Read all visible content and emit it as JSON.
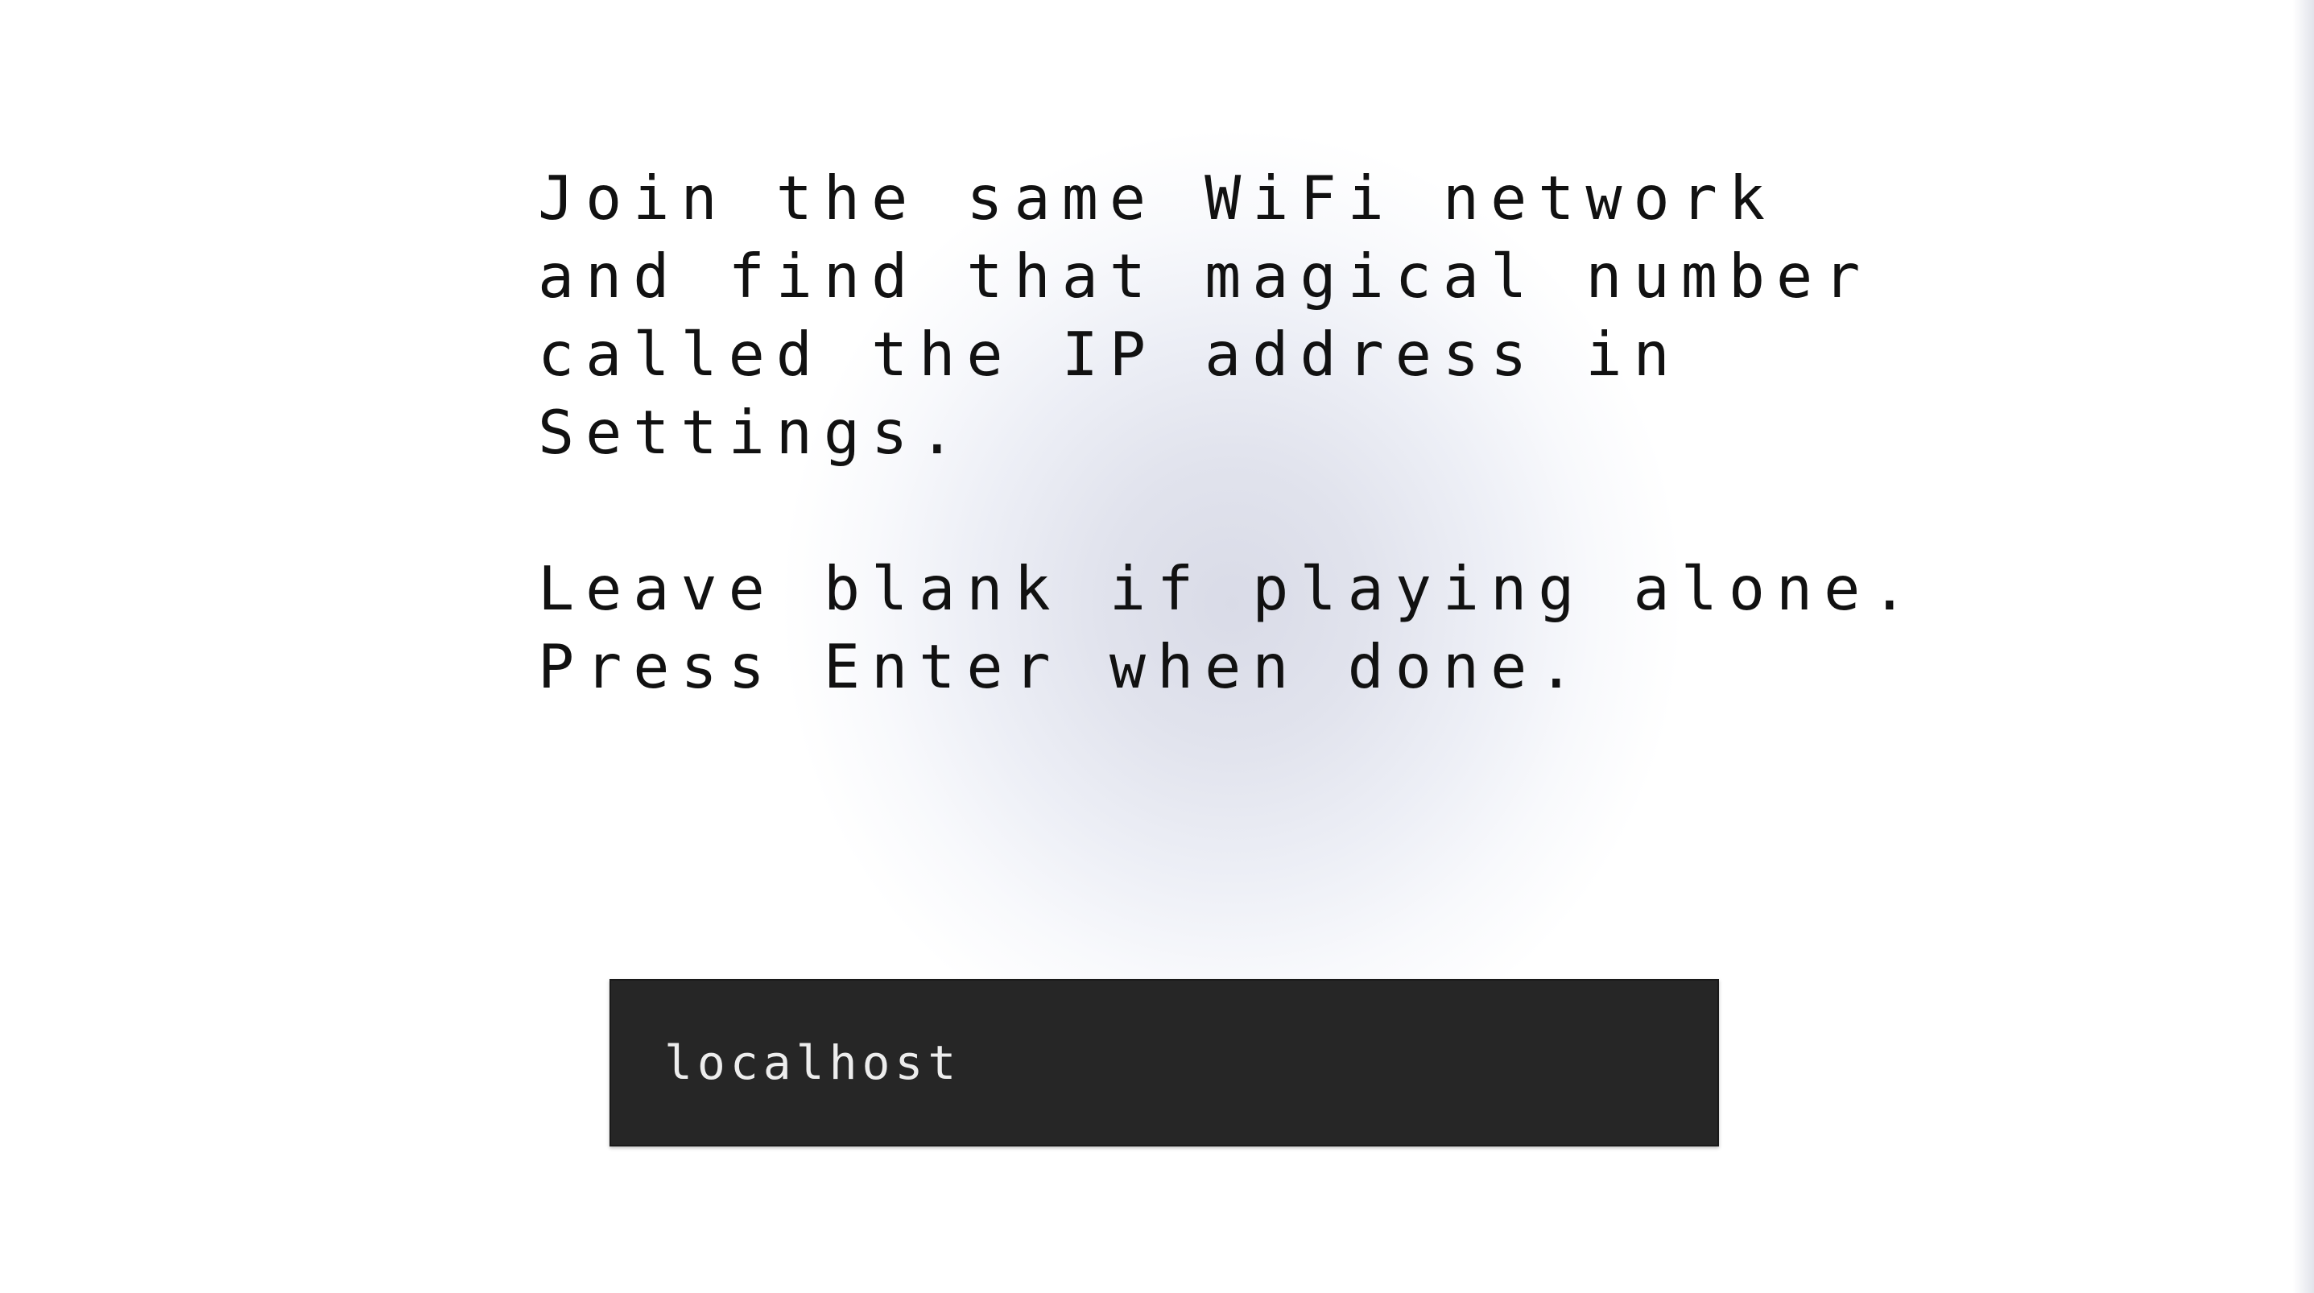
{
  "instructions": {
    "paragraph1": "Join the same WiFi network\nand find that magical number\ncalled the IP address in\nSettings.",
    "paragraph2": "Leave blank if playing alone.\nPress Enter when done."
  },
  "ip_field": {
    "value": "localhost"
  },
  "colors": {
    "text": "#111111",
    "input_background": "#262626",
    "input_text": "#ededed",
    "glow": "#d9dbe7"
  }
}
